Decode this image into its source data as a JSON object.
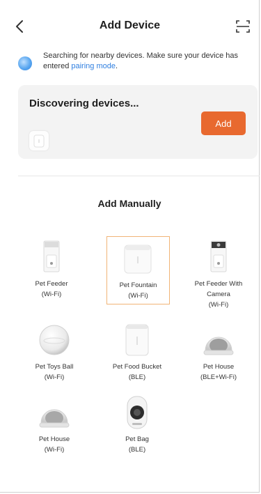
{
  "header": {
    "back_icon": "chevron-left-icon",
    "title": "Add Device",
    "scan_icon": "scan-icon"
  },
  "notice": {
    "text": "Searching for nearby devices. Make sure your device has entered ",
    "link": "pairing mode",
    "suffix": ".",
    "icon": "searching-indicator-icon"
  },
  "discover": {
    "title": "Discovering devices...",
    "add_label": "Add",
    "accent": "#e8692f"
  },
  "manual": {
    "title": "Add Manually",
    "devices": [
      {
        "name": "Pet Feeder",
        "sub": "(Wi-Fi)",
        "icon": "pet-feeder-icon"
      },
      {
        "name": "Pet Fountain",
        "sub": "(Wi-Fi)",
        "icon": "pet-fountain-icon",
        "selected": true
      },
      {
        "name": "Pet Feeder With",
        "name2": "Camera",
        "sub": "(Wi-Fi)",
        "icon": "pet-feeder-camera-icon"
      },
      {
        "name": "Pet Toys Ball",
        "sub": "(Wi-Fi)",
        "icon": "pet-toys-ball-icon"
      },
      {
        "name": "Pet Food Bucket",
        "sub": "(BLE)",
        "icon": "pet-food-bucket-icon"
      },
      {
        "name": "Pet House",
        "sub": "(BLE+Wi-Fi)",
        "icon": "pet-house-icon"
      },
      {
        "name": "Pet House",
        "sub": "(Wi-Fi)",
        "icon": "pet-house-icon"
      },
      {
        "name": "Pet Bag",
        "sub": "(BLE)",
        "icon": "pet-bag-icon"
      }
    ]
  },
  "colors": {
    "link": "#2f7fe0",
    "selected_border": "#f1b476",
    "card_bg": "#f3f3f3"
  }
}
